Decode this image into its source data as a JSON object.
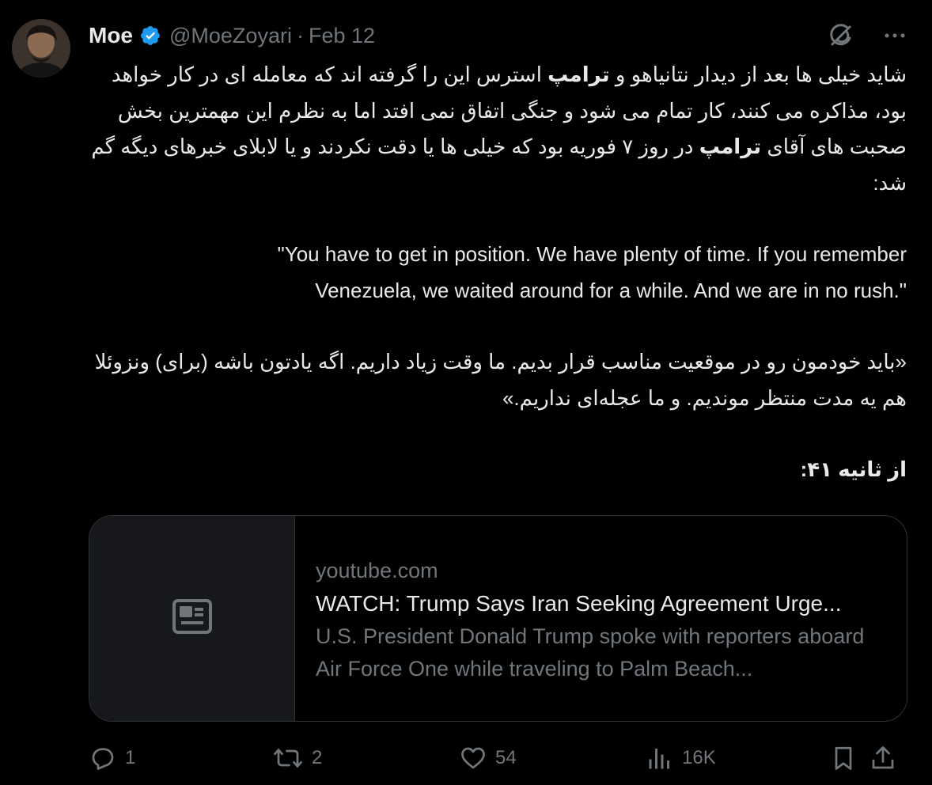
{
  "author": {
    "name": "Moe",
    "handle": "@MoeZoyari",
    "separator": "·",
    "date": "Feb 12",
    "verified": true
  },
  "header_icons": [
    "grok-icon",
    "more-icon"
  ],
  "body": {
    "para1_part1": "شاید خیلی ها بعد از دیدار نتانیاهو و ",
    "para1_bold1": "ترامپ",
    "para1_part2": " استرس این را گرفته اند که معامله ای در کار خواهد بود، مذاکره می کنند، کار تمام می شود و جنگی اتفاق نمی افتد اما به نظرم این مهمترین بخش صحبت های آقای ",
    "para1_bold2": "ترامپ",
    "para1_part3": " در روز ۷ فوریه بود که خیلی ها یا دقت نکردند و یا لابلای خبرهای دیگه گم شد:",
    "quote_en_line1": "You have to get in position. We have plenty of time. If you remember\"",
    "quote_en_line2": "\".Venezuela, we waited around for a while. And we are in no rush",
    "quote_fa": "«باید خودمون رو در موقعیت مناسب قرار بدیم. ما وقت زیاد داریم. اگه یادتون باشه (برای) ونزوئلا هم یه مدت منتظر موندیم. و ما عجله‌ای نداریم.»",
    "timestamp_note": "از ثانیه ۴۱:"
  },
  "card": {
    "domain": "youtube.com",
    "title": "WATCH: Trump Says Iran Seeking Agreement Urge...",
    "description": "U.S. President Donald Trump spoke with reporters aboard Air Force One while traveling to Palm Beach...",
    "thumb_icon": "article-icon"
  },
  "actions": {
    "replies": "1",
    "reposts": "2",
    "likes": "54",
    "views": "16K"
  },
  "colors": {
    "background": "#000000",
    "text": "#e7e9ea",
    "muted": "#71767b",
    "verified": "#1d9bf0",
    "border": "#2f3336"
  }
}
